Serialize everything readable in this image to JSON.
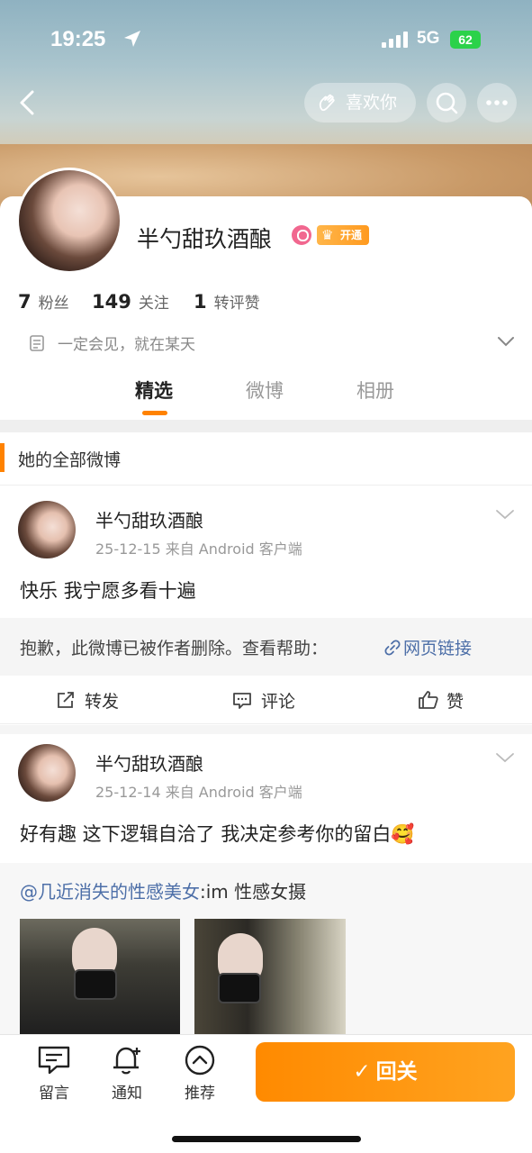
{
  "status_bar": {
    "time": "19:25",
    "network": "5G",
    "battery": "62"
  },
  "header": {
    "like_label": "喜欢你"
  },
  "profile": {
    "name": "半勺甜玖酒酿",
    "vip_label": "开通",
    "stats": [
      {
        "value": "7",
        "label": "粉丝"
      },
      {
        "value": "149",
        "label": "关注"
      },
      {
        "value": "1",
        "label": "转评赞"
      }
    ],
    "bio": "一定会见，就在某天"
  },
  "tabs": [
    {
      "label": "精选",
      "active": true
    },
    {
      "label": "微博",
      "active": false
    },
    {
      "label": "相册",
      "active": false
    }
  ],
  "section_title": "她的全部微博",
  "posts": [
    {
      "author": "半勺甜玖酒酿",
      "date": "25-12-15",
      "source": "来自 Android 客户端",
      "text": "快乐 我宁愿多看十遍",
      "deleted_notice": "抱歉，此微博已被作者删除。查看帮助：",
      "help_link": "网页链接",
      "actions": {
        "repost": "转发",
        "comment": "评论",
        "like": "赞"
      }
    },
    {
      "author": "半勺甜玖酒酿",
      "date": "25-12-14",
      "source": "来自 Android 客户端",
      "text": "好有趣 这下逻辑自洽了 我决定参考你的留白",
      "emoji": "🥰",
      "repost_user": "@几近消失的性感美女",
      "repost_text": ":im 性感女摄"
    }
  ],
  "bottom_bar": {
    "items": [
      {
        "label": "留言",
        "icon": "message-icon"
      },
      {
        "label": "通知",
        "icon": "bell-icon"
      },
      {
        "label": "推荐",
        "icon": "recommend-icon"
      }
    ],
    "follow_label": "回关"
  },
  "colors": {
    "accent": "#ff8200",
    "link": "#4d6fa8",
    "vip": "#ff9a1f"
  }
}
